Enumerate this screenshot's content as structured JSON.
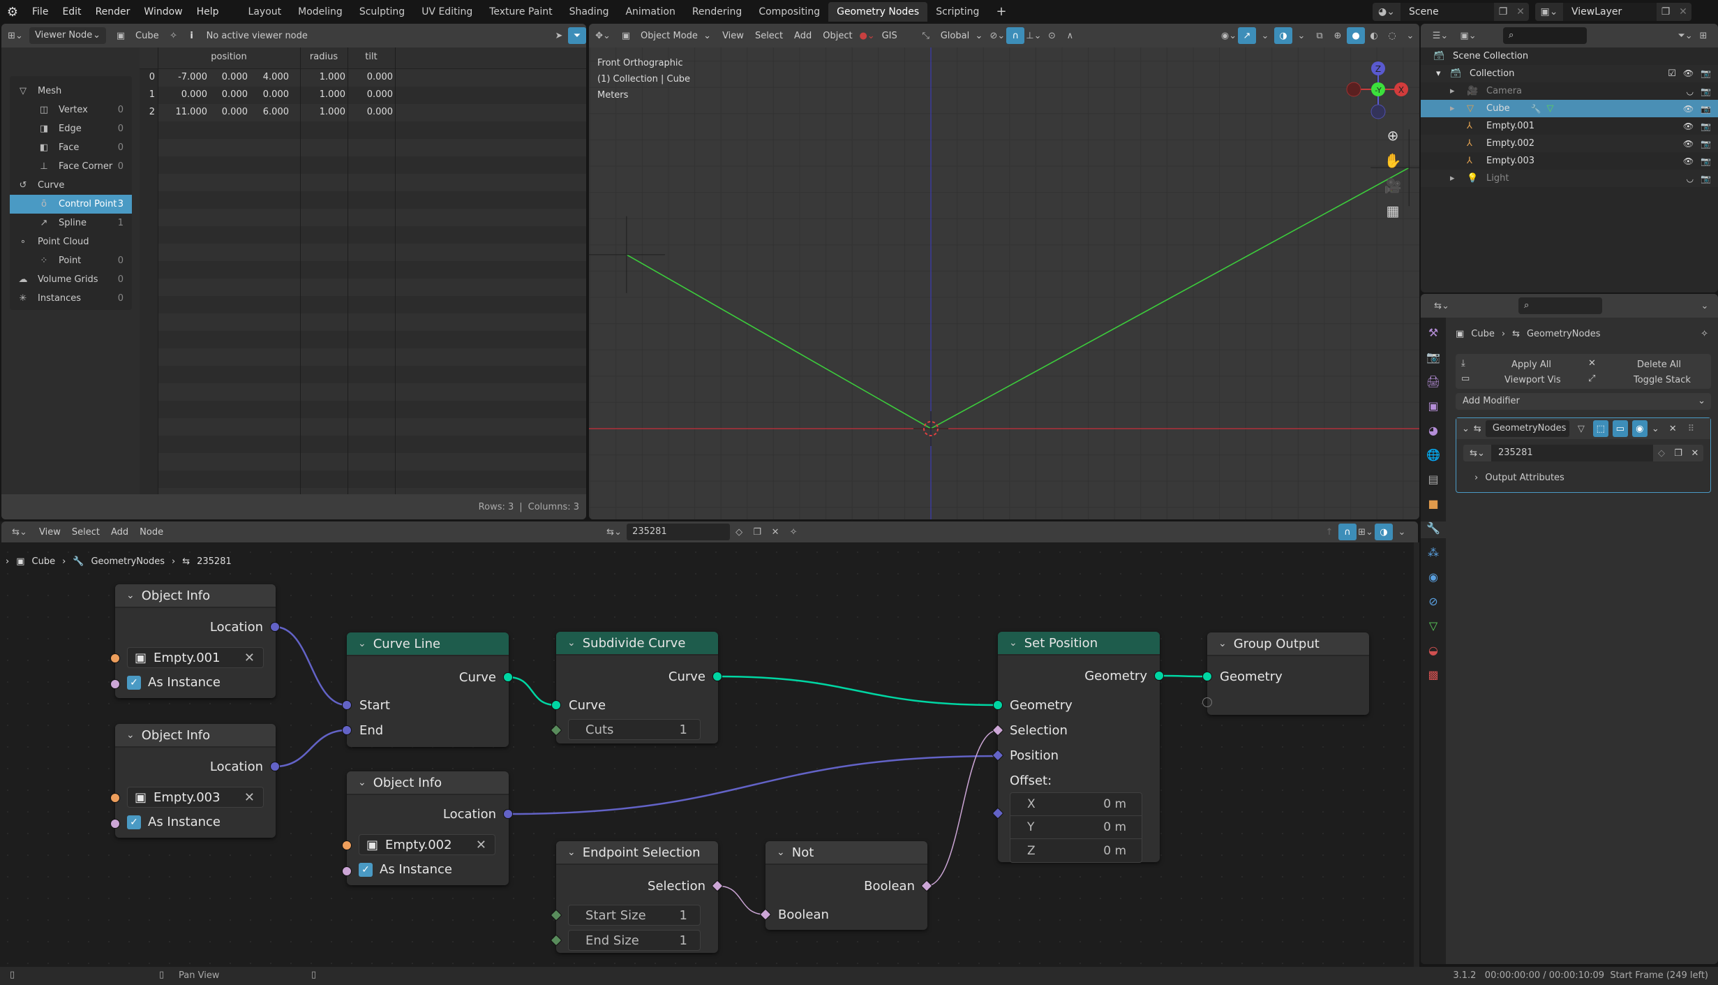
{
  "topbar": {
    "menus": [
      "File",
      "Edit",
      "Render",
      "Window",
      "Help"
    ],
    "workspaces": [
      "Layout",
      "Modeling",
      "Sculpting",
      "UV Editing",
      "Texture Paint",
      "Shading",
      "Animation",
      "Rendering",
      "Compositing",
      "Geometry Nodes",
      "Scripting"
    ],
    "active_workspace": "Geometry Nodes",
    "add_workspace": "+",
    "scene": "Scene",
    "view_layer": "ViewLayer"
  },
  "spreadsheet": {
    "header": {
      "viewer_mode": "Viewer Node",
      "object": "Cube",
      "viewer_status": "No active viewer node"
    },
    "sidebar": [
      {
        "label": "Mesh",
        "icon": "mesh-icon",
        "level": 0,
        "count": ""
      },
      {
        "label": "Vertex",
        "icon": "vertex-icon",
        "level": 1,
        "count": "0"
      },
      {
        "label": "Edge",
        "icon": "edge-icon",
        "level": 1,
        "count": "0"
      },
      {
        "label": "Face",
        "icon": "face-icon",
        "level": 1,
        "count": "0"
      },
      {
        "label": "Face Corner",
        "icon": "face-corner-icon",
        "level": 1,
        "count": "0"
      },
      {
        "label": "Curve",
        "icon": "curve-icon",
        "level": 0,
        "count": ""
      },
      {
        "label": "Control Point",
        "icon": "control-point-icon",
        "level": 1,
        "count": "3",
        "selected": true
      },
      {
        "label": "Spline",
        "icon": "spline-icon",
        "level": 1,
        "count": "1"
      },
      {
        "label": "Point Cloud",
        "icon": "point-cloud-icon",
        "level": 0,
        "count": ""
      },
      {
        "label": "Point",
        "icon": "point-icon",
        "level": 1,
        "count": "0"
      },
      {
        "label": "Volume Grids",
        "icon": "volume-icon",
        "level": 0,
        "count": "0"
      },
      {
        "label": "Instances",
        "icon": "instances-icon",
        "level": 0,
        "count": "0"
      }
    ],
    "columns": [
      "position",
      "radius",
      "tilt"
    ],
    "rows": [
      {
        "index": "0",
        "position": [
          "-7.000",
          "0.000",
          "4.000"
        ],
        "radius": "1.000",
        "tilt": "0.000"
      },
      {
        "index": "1",
        "position": [
          "0.000",
          "0.000",
          "0.000"
        ],
        "radius": "1.000",
        "tilt": "0.000"
      },
      {
        "index": "2",
        "position": [
          "11.000",
          "0.000",
          "6.000"
        ],
        "radius": "1.000",
        "tilt": "0.000"
      }
    ],
    "footer": {
      "rows": "Rows: 3",
      "columns": "Columns: 3"
    }
  },
  "viewport": {
    "header": {
      "mode": "Object Mode",
      "view": "View",
      "select": "Select",
      "add": "Add",
      "object": "Object",
      "gis": "GIS",
      "orientation": "Global"
    },
    "overlay_text": [
      "Front Orthographic",
      "(1) Collection | Cube",
      "Meters"
    ],
    "gizmo": {
      "z": "Z",
      "y": "-Y",
      "x": "X"
    },
    "colors": {
      "curve": "#3ccc3c",
      "x_axis": "#b0303a",
      "z_axis": "#3a3a9a"
    }
  },
  "outliner": {
    "items": [
      {
        "label": "Scene Collection",
        "icon": "collection-icon",
        "level": 0
      },
      {
        "label": "Collection",
        "icon": "collection-icon",
        "level": 1,
        "expanded": true,
        "checked": true
      },
      {
        "label": "Camera",
        "icon": "camera-icon",
        "level": 2,
        "dim": true,
        "hidden": true
      },
      {
        "label": "Cube",
        "icon": "mesh-object-icon",
        "level": 2,
        "selected": true
      },
      {
        "label": "Empty.001",
        "icon": "empty-icon",
        "level": 2
      },
      {
        "label": "Empty.002",
        "icon": "empty-icon",
        "level": 2
      },
      {
        "label": "Empty.003",
        "icon": "empty-icon",
        "level": 2
      },
      {
        "label": "Light",
        "icon": "light-icon",
        "level": 2,
        "dim": true,
        "hidden": true
      }
    ]
  },
  "properties": {
    "breadcrumb": [
      "Cube",
      "GeometryNodes"
    ],
    "apply_all": "Apply All",
    "delete_all": "Delete All",
    "viewport_vis": "Viewport Vis",
    "toggle_stack": "Toggle Stack",
    "add_modifier": "Add Modifier",
    "modifier_name": "GeometryNodes",
    "node_group": "235281",
    "output_attributes": "Output Attributes"
  },
  "node_editor": {
    "menus": [
      "View",
      "Select",
      "Add",
      "Node"
    ],
    "node_group": "235281",
    "breadcrumb": [
      "Cube",
      "GeometryNodes",
      "235281"
    ],
    "nodes": {
      "obj1": {
        "title": "Object Info",
        "output": "Location",
        "object": "Empty.001",
        "as_instance": "As Instance"
      },
      "obj3": {
        "title": "Object Info",
        "output": "Location",
        "object": "Empty.003",
        "as_instance": "As Instance"
      },
      "obj2": {
        "title": "Object Info",
        "output": "Location",
        "object": "Empty.002",
        "as_instance": "As Instance"
      },
      "curve_line": {
        "title": "Curve Line",
        "output": "Curve",
        "in_start": "Start",
        "in_end": "End"
      },
      "subdivide": {
        "title": "Subdivide Curve",
        "output": "Curve",
        "input": "Curve",
        "cuts_label": "Cuts",
        "cuts_value": "1"
      },
      "endpoint": {
        "title": "Endpoint Selection",
        "output": "Selection",
        "start_label": "Start Size",
        "start_value": "1",
        "end_label": "End Size",
        "end_value": "1"
      },
      "not": {
        "title": "Not",
        "output": "Boolean",
        "input": "Boolean"
      },
      "set_position": {
        "title": "Set Position",
        "output": "Geometry",
        "in_geometry": "Geometry",
        "in_selection": "Selection",
        "in_position": "Position",
        "offset_label": "Offset:",
        "x_label": "X",
        "x_value": "0 m",
        "y_label": "Y",
        "y_value": "0 m",
        "z_label": "Z",
        "z_value": "0 m"
      },
      "group_output": {
        "title": "Group Output",
        "input": "Geometry"
      }
    }
  },
  "status": {
    "pan_view": "Pan View",
    "info": "3.1.2   00:00:00:00 / 00:00:10:09  Start Frame (249 left)"
  }
}
